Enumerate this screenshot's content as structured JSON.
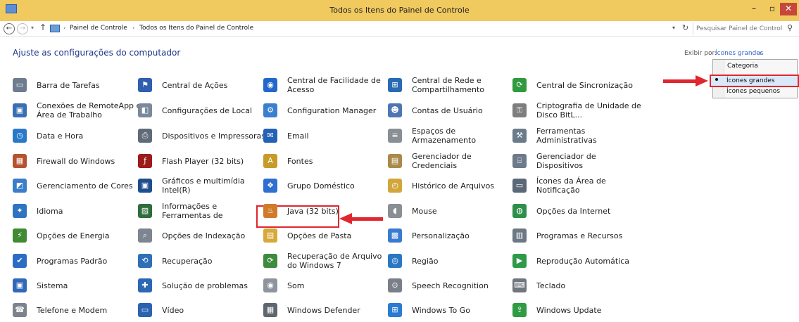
{
  "window": {
    "title": "Todos os Itens do Painel de Controle",
    "minimize": "–",
    "maximize": "▫",
    "close": "✕"
  },
  "nav": {
    "back": "←",
    "forward": "→",
    "history": "▾",
    "up": "↑"
  },
  "address": {
    "breadcrumbs": [
      "Painel de Controle",
      "Todos os Itens do Painel de Controle"
    ],
    "separator": "›",
    "dropdown": "▾",
    "refresh": "↻"
  },
  "search": {
    "placeholder": "Pesquisar Painel de Controle",
    "icon": "⚲"
  },
  "content": {
    "heading": "Ajuste as configurações do computador",
    "view_by_label": "Exibir por:",
    "view_by_value": "Ícones grandes",
    "view_by_arrow": "▾"
  },
  "view_menu": [
    "Categoria",
    "Ícones grandes",
    "Ícones pequenos"
  ],
  "view_menu_selected": "Ícones grandes",
  "items": [
    {
      "label": "Barra de Tarefas",
      "icon": "taskbar-icon",
      "color": "#6e7c8f",
      "glyph": "▭"
    },
    {
      "label": "Central de Ações",
      "icon": "flag-icon",
      "color": "#2f5fae",
      "glyph": "⚑"
    },
    {
      "label": "Central de Facilidade de Acesso",
      "icon": "ease-of-access-icon",
      "color": "#2267c9",
      "glyph": "◉"
    },
    {
      "label": "Central de Rede e Compartilhamento",
      "icon": "network-icon",
      "color": "#2a6ab5",
      "glyph": "⊞"
    },
    {
      "label": "Central de Sincronização",
      "icon": "sync-icon",
      "color": "#2f9a3e",
      "glyph": "⟳"
    },
    {
      "label": "Conexões de RemoteApp e Área de Trabalho",
      "icon": "remoteapp-icon",
      "color": "#3a6fb4",
      "glyph": "▣"
    },
    {
      "label": "Configurações de Local",
      "icon": "location-icon",
      "color": "#7a8a9a",
      "glyph": "◧"
    },
    {
      "label": "Configuration Manager",
      "icon": "configuration-manager-icon",
      "color": "#3b7fd0",
      "glyph": "⚙"
    },
    {
      "label": "Contas de Usuário",
      "icon": "user-accounts-icon",
      "color": "#4c77b3",
      "glyph": "☻"
    },
    {
      "label": "Criptografia de Unidade de Disco BitL...",
      "icon": "bitlocker-icon",
      "color": "#7e7e7e",
      "glyph": "⚿"
    },
    {
      "label": "Data e Hora",
      "icon": "clock-icon",
      "color": "#2a79c8",
      "glyph": "◷"
    },
    {
      "label": "Dispositivos e Impressoras",
      "icon": "printer-icon",
      "color": "#5f6b78",
      "glyph": "⎙"
    },
    {
      "label": "Email",
      "icon": "email-icon",
      "color": "#2561b5",
      "glyph": "✉"
    },
    {
      "label": "Espaços de Armazenamento",
      "icon": "storage-spaces-icon",
      "color": "#8a8f96",
      "glyph": "≡"
    },
    {
      "label": "Ferramentas Administrativas",
      "icon": "admin-tools-icon",
      "color": "#6b7b8c",
      "glyph": "⚒"
    },
    {
      "label": "Firewall do Windows",
      "icon": "firewall-icon",
      "color": "#b5532f",
      "glyph": "▦"
    },
    {
      "label": "Flash Player (32 bits)",
      "icon": "flash-icon",
      "color": "#9c1c1c",
      "glyph": "ƒ"
    },
    {
      "label": "Fontes",
      "icon": "fonts-icon",
      "color": "#c79b2a",
      "glyph": "A"
    },
    {
      "label": "Gerenciador de Credenciais",
      "icon": "credentials-icon",
      "color": "#a98a4a",
      "glyph": "▤"
    },
    {
      "label": "Gerenciador de Dispositivos",
      "icon": "device-manager-icon",
      "color": "#6c7a89",
      "glyph": "⌸"
    },
    {
      "label": "Gerenciamento de Cores",
      "icon": "color-management-icon",
      "color": "#3a7dc9",
      "glyph": "◩"
    },
    {
      "label": "Gráficos e multimídia Intel(R)",
      "icon": "intel-graphics-icon",
      "color": "#1f4e8c",
      "glyph": "▣"
    },
    {
      "label": "Grupo Doméstico",
      "icon": "homegroup-icon",
      "color": "#2e6fd0",
      "glyph": "❖"
    },
    {
      "label": "Histórico de Arquivos",
      "icon": "file-history-icon",
      "color": "#d3a63c",
      "glyph": "◴"
    },
    {
      "label": "Ícones da Área de Notificação",
      "icon": "notification-icons-icon",
      "color": "#5a6877",
      "glyph": "▭"
    },
    {
      "label": "Idioma",
      "icon": "language-icon",
      "color": "#2f74c0",
      "glyph": "✦"
    },
    {
      "label": "Informações e Ferramentas de Desempenho",
      "icon": "performance-icon",
      "color": "#2f6d3c",
      "glyph": "▨"
    },
    {
      "label": "Java (32 bits)",
      "icon": "java-icon",
      "color": "#d07a2a",
      "glyph": "♨"
    },
    {
      "label": "Mouse",
      "icon": "mouse-icon",
      "color": "#8a8f96",
      "glyph": "◖"
    },
    {
      "label": "Opções da Internet",
      "icon": "internet-options-icon",
      "color": "#2d8f4a",
      "glyph": "◍"
    },
    {
      "label": "Opções de Energia",
      "icon": "power-options-icon",
      "color": "#3f8a32",
      "glyph": "⚡"
    },
    {
      "label": "Opções de Indexação",
      "icon": "indexing-icon",
      "color": "#7d8590",
      "glyph": "⌕"
    },
    {
      "label": "Opções de Pasta",
      "icon": "folder-options-icon",
      "color": "#d7a83a",
      "glyph": "▤"
    },
    {
      "label": "Personalização",
      "icon": "personalization-icon",
      "color": "#3a7bd0",
      "glyph": "▩"
    },
    {
      "label": "Programas e Recursos",
      "icon": "programs-icon",
      "color": "#6d7885",
      "glyph": "▥"
    },
    {
      "label": "Programas Padrão",
      "icon": "default-programs-icon",
      "color": "#2b6cc4",
      "glyph": "✔"
    },
    {
      "label": "Recuperação",
      "icon": "recovery-icon",
      "color": "#2f6fb8",
      "glyph": "⟲"
    },
    {
      "label": "Recuperação de Arquivo do Windows 7",
      "icon": "windows7-recovery-icon",
      "color": "#3d8b3d",
      "glyph": "⟳"
    },
    {
      "label": "Região",
      "icon": "region-icon",
      "color": "#2a78c4",
      "glyph": "◎"
    },
    {
      "label": "Reprodução Automática",
      "icon": "autoplay-icon",
      "color": "#2d9a47",
      "glyph": "▶"
    },
    {
      "label": "Sistema",
      "icon": "system-icon",
      "color": "#3169b8",
      "glyph": "▣"
    },
    {
      "label": "Solução de problemas",
      "icon": "troubleshooting-icon",
      "color": "#2c67b5",
      "glyph": "✚"
    },
    {
      "label": "Som",
      "icon": "sound-icon",
      "color": "#8e959d",
      "glyph": "◉"
    },
    {
      "label": "Speech Recognition",
      "icon": "microphone-icon",
      "color": "#7a8089",
      "glyph": "⊙"
    },
    {
      "label": "Teclado",
      "icon": "keyboard-icon",
      "color": "#6f767e",
      "glyph": "⌨"
    },
    {
      "label": "Telefone e Modem",
      "icon": "phone-icon",
      "color": "#7b838c",
      "glyph": "☎"
    },
    {
      "label": "Vídeo",
      "icon": "display-icon",
      "color": "#2c63b0",
      "glyph": "▭"
    },
    {
      "label": "Windows Defender",
      "icon": "windows-defender-icon",
      "color": "#5e6670",
      "glyph": "▦"
    },
    {
      "label": "Windows To Go",
      "icon": "windows-to-go-icon",
      "color": "#2a7bd3",
      "glyph": "⊞"
    },
    {
      "label": "Windows Update",
      "icon": "windows-update-icon",
      "color": "#2f9b42",
      "glyph": "⇪"
    }
  ],
  "highlight_color": "#e0262f"
}
